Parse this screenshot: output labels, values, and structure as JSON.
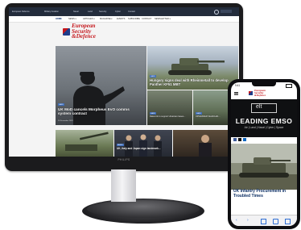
{
  "site": {
    "top_nav_items": [
      "European Defence",
      "Military Aviation",
      "Naval",
      "Land",
      "Security",
      "Cyber",
      "Contact"
    ],
    "menu": [
      "HOME",
      "NEWS ▾",
      "ARTICLES ▾",
      "MAGAZINE ▾",
      "EVENTS",
      "SUBSCRIBE",
      "CONTACT",
      "NEWSLETTER ▾"
    ],
    "logo_line1": "European",
    "logo_line2": "Security",
    "logo_line3": "&Defence"
  },
  "articles": {
    "main_title": "UK MoD cancels Morpheus EvO comms system contract",
    "main_tag": "LAND",
    "main_date": "20 December 2023",
    "top_right_title": "Hungary signs deal with Rheinmetall to develop Panther KF51 MBT",
    "top_right_tag": "LAND",
    "small1_title": "Rakovnik to support Ukrainian bases...",
    "small1_tag": "LAND",
    "small2_title": "UPGRADED VEHICLES...",
    "small2_tag": "LAND",
    "bottom1_title": "UK, Italy and Japan sign landmark...",
    "bottom1_tag": "NEWS"
  },
  "monitor": {
    "brand": "PHILIPS"
  },
  "phone": {
    "status_time": "9:41",
    "ad_brand": "elt",
    "ad_headline": "LEADING EMSO",
    "ad_sub": "Air | Land | Naval | Cyber | Space",
    "article_title": "UK Infantry Procurement in Troubled Times",
    "logo_line1": "European",
    "logo_line2": "Security",
    "logo_line3": "&Defence"
  }
}
